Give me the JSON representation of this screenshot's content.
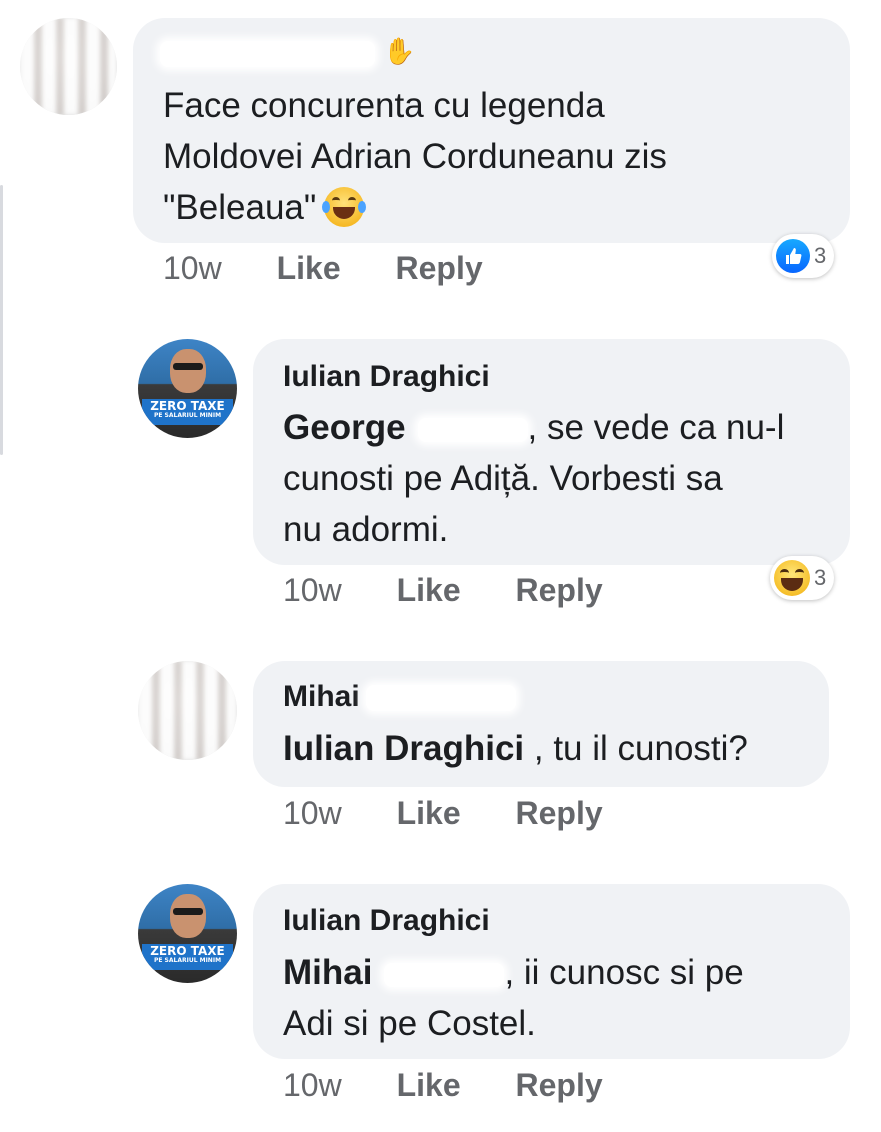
{
  "comments": [
    {
      "author": "",
      "text_lines": [
        "Face concurenta cu legenda",
        "Moldovei Adrian Corduneanu zis",
        "\"Beleaua\""
      ],
      "emoji": "laugh-tears-emoji",
      "time": "10w",
      "like_label": "Like",
      "reply_label": "Reply",
      "reaction": {
        "type": "like",
        "count": "3"
      }
    },
    {
      "author": "Iulian Draghici",
      "mention": "George",
      "text_first_rest": ", se vede ca nu-l",
      "text_lines": [
        "cunosti pe Adiță. Vorbesti sa",
        "nu adormi."
      ],
      "avatar_banner": "ZERO TAXE",
      "avatar_banner_sub": "PE SALARIUL MINIM",
      "time": "10w",
      "like_label": "Like",
      "reply_label": "Reply",
      "reaction": {
        "type": "haha",
        "count": "3"
      }
    },
    {
      "author": "Mihai",
      "mention": "Iulian Draghici",
      "text_rest": " , tu il cunosti?",
      "time": "10w",
      "like_label": "Like",
      "reply_label": "Reply"
    },
    {
      "author": "Iulian Draghici",
      "mention": "Mihai",
      "text_first_rest": ", ii cunosc si pe",
      "text_lines": [
        "Adi si pe Costel."
      ],
      "avatar_banner": "ZERO TAXE",
      "avatar_banner_sub": "PE SALARIUL MINIM",
      "time": "10w",
      "like_label": "Like",
      "reply_label": "Reply"
    }
  ]
}
